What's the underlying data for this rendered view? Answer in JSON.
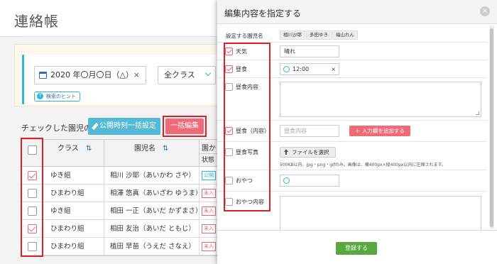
{
  "page": {
    "title": "連絡帳",
    "search": {
      "date_value": "2020 年〇月〇日（△）",
      "date_clear": "×",
      "class_value": "全クラス",
      "hint_label": "検索のヒント",
      "hint_icon": "?"
    },
    "action_label": "チェックした園児の",
    "publish_button": "公開時刻一括設定",
    "bulk_edit_button": "一括編集",
    "table": {
      "headers": {
        "class": "クラス",
        "name": "園児名",
        "col3": "園か",
        "col3_sub": "状態"
      },
      "sort_glyph": "⇅",
      "rows": [
        {
          "checked": true,
          "class": "ゆき組",
          "name": "相川 沙耶（あいかわ さや）",
          "tag": "公開"
        },
        {
          "checked": false,
          "class": "ひまわり組",
          "name": "相澤 悠真（あいざわ ゆうま）",
          "tag": "未入"
        },
        {
          "checked": false,
          "class": "ゆき組",
          "name": "相田 一正（あいだ かずまさ）",
          "tag": "未入"
        },
        {
          "checked": true,
          "class": "ひまわり組",
          "name": "相田 友治（あいだ ともじ）",
          "tag": "未入"
        },
        {
          "checked": false,
          "class": "ひまわり組",
          "name": "植田 早苗（うえだ さなえ）",
          "tag": "未入"
        }
      ]
    }
  },
  "modal": {
    "title": "編集内容を指定する",
    "close_glyph": "×",
    "children_label": "設定する園児名",
    "children": [
      "相川沙耶",
      "多田ゆき",
      "福山れん"
    ],
    "fields": {
      "weather": {
        "label": "天気",
        "checked": true,
        "value": "晴れ"
      },
      "lunch": {
        "label": "昼食",
        "checked": true,
        "value": "12:00",
        "clear": "×"
      },
      "lunch_content": {
        "label": "昼食内容",
        "checked": false
      },
      "lunch_item": {
        "label": "昼食（内容）",
        "checked": true,
        "placeholder": "昼食内容",
        "add_button": "＋ 入力欄を追加する"
      },
      "lunch_photo": {
        "label": "昼食写真",
        "checked": false,
        "file_button": "ファイルを選択",
        "note": "500KB以内、jpg・png・gifのみ。画像は、横400px×縦400px以内に圧縮されます。"
      },
      "snack": {
        "label": "おやつ",
        "checked": false
      },
      "snack_content": {
        "label": "おやつ内容",
        "checked": false
      }
    },
    "register_button": "登録する"
  }
}
